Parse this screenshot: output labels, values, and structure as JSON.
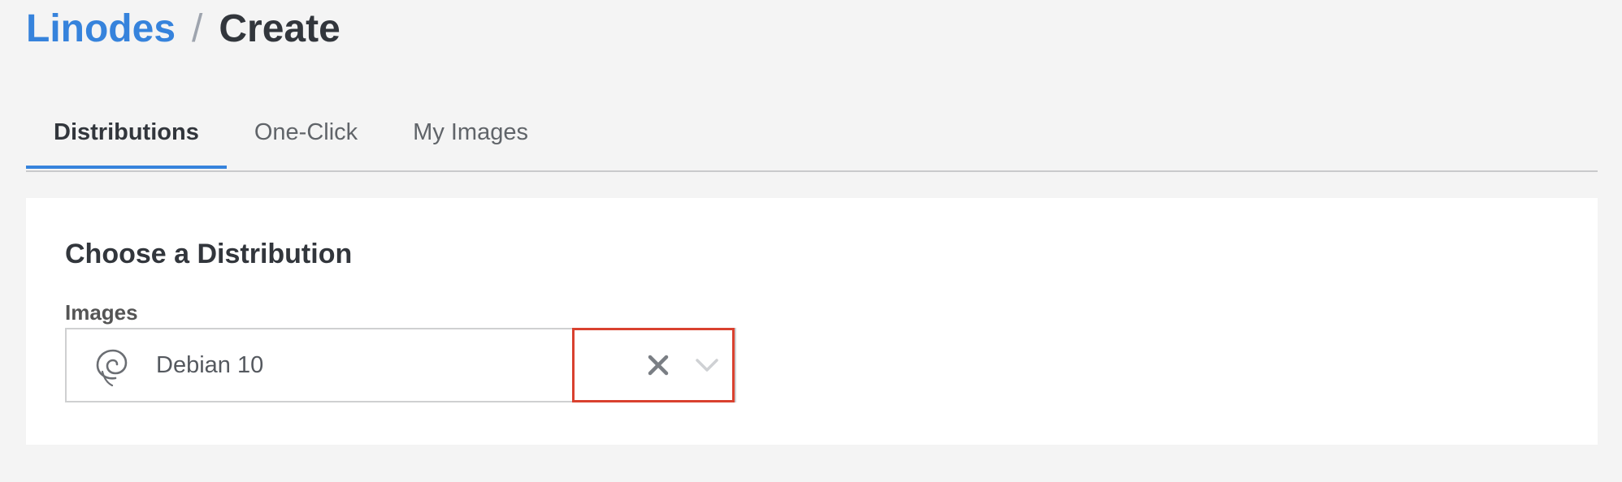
{
  "breadcrumb": {
    "parent": "Linodes",
    "separator": "/",
    "current": "Create"
  },
  "tabs": [
    {
      "label": "Distributions",
      "active": true
    },
    {
      "label": "One-Click",
      "active": false
    },
    {
      "label": "My Images",
      "active": false
    }
  ],
  "panel": {
    "title": "Choose a Distribution",
    "images_label": "Images",
    "selected_image": "Debian 10",
    "selected_icon": "debian-swirl-icon"
  },
  "colors": {
    "link_blue": "#3683dc",
    "highlight_red": "#d9412f",
    "page_bg": "#f4f4f4"
  }
}
